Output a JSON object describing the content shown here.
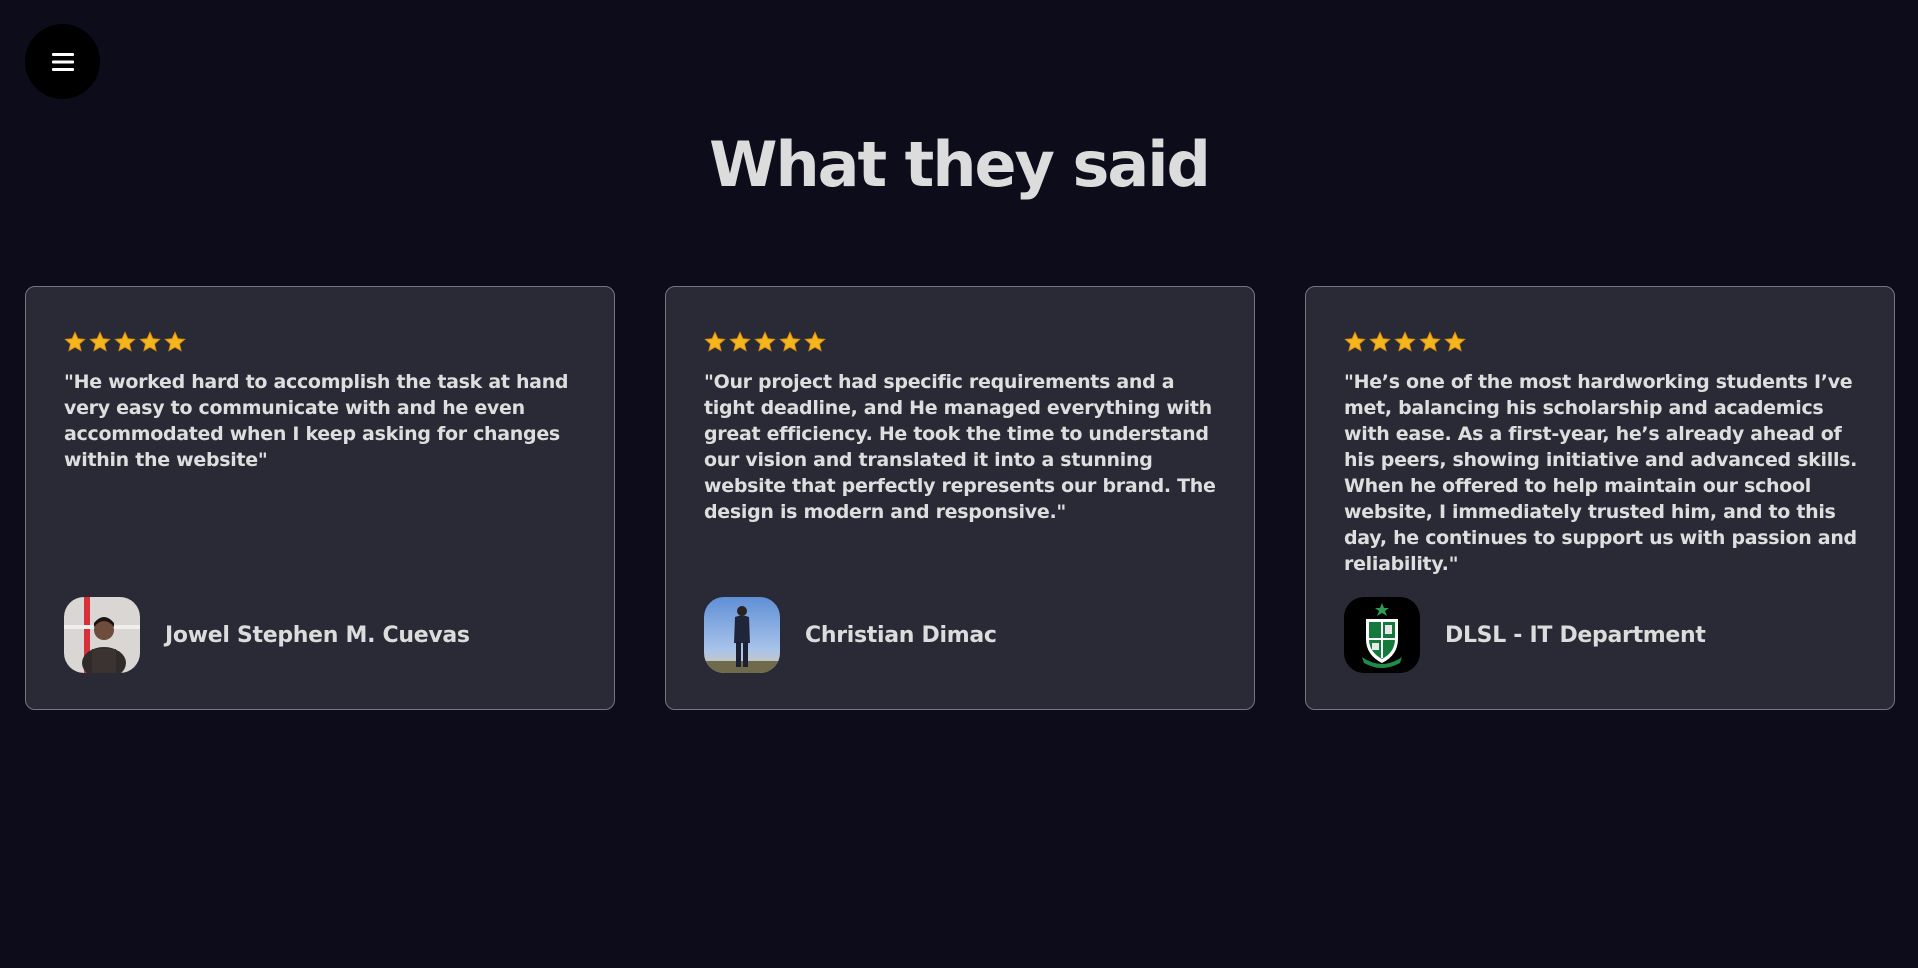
{
  "nav": {
    "menu_icon": "hamburger-icon"
  },
  "section": {
    "title": "What they said"
  },
  "colors": {
    "background": "#0c0c1b",
    "card_background": "#2a2a37",
    "card_border": "#767682",
    "star": "#f5b51e"
  },
  "testimonials": [
    {
      "rating": 5,
      "quote": "\"He worked hard to accomplish the task at hand very easy to communicate with and he even accommodated when I keep asking for changes within the website\"",
      "name": "Jowel Stephen M. Cuevas",
      "avatar": "person-photo"
    },
    {
      "rating": 5,
      "quote": "\"Our project had specific requirements and a tight deadline, and He managed everything with great efficiency. He took the time to understand our vision and translated it into a stunning website that perfectly represents our brand. The design is modern and responsive.\"",
      "name": "Christian Dimac",
      "avatar": "person-photo"
    },
    {
      "rating": 5,
      "quote": "\"He’s one of the most hardworking students I’ve met, balancing his scholarship and academics with ease. As a first-year, he’s already ahead of his peers, showing initiative and advanced skills. When he offered to help maintain our school website, I immediately trusted him, and to this day, he continues to support us with passion and reliability.\"",
      "name": "DLSL - IT Department",
      "avatar": "school-crest-logo"
    }
  ]
}
